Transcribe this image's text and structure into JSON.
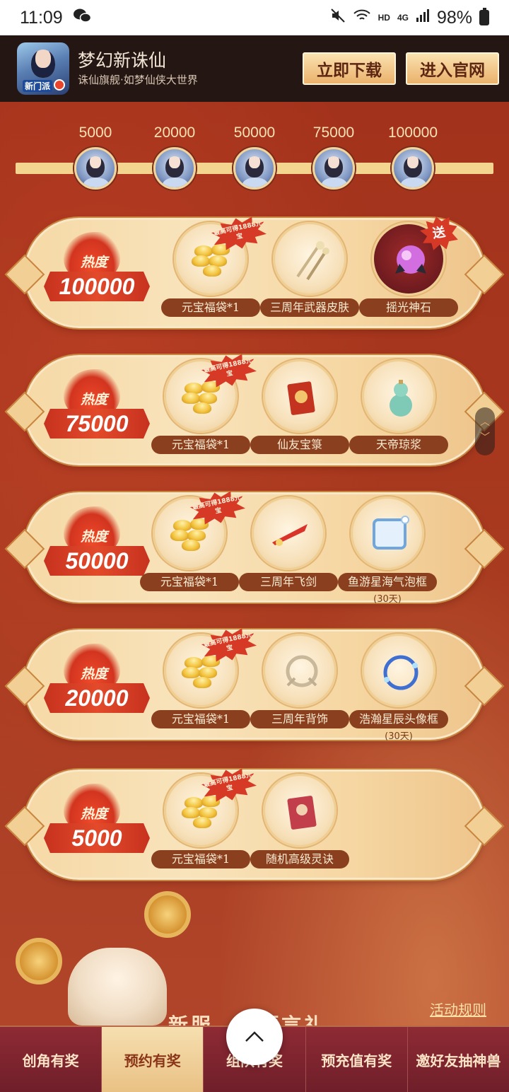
{
  "status_bar": {
    "time": "11:09",
    "network": "HD",
    "signal": "4G",
    "battery": "98%"
  },
  "header": {
    "app_name": "梦幻新诛仙",
    "subtitle": "诛仙旗舰·如梦仙侠大世界",
    "logo_text": "新门派",
    "download_label": "立即下载",
    "website_label": "进入官网"
  },
  "progress": {
    "milestones": [
      "5000",
      "20000",
      "50000",
      "75000",
      "100000"
    ]
  },
  "tiers": [
    {
      "heat_label": "热度",
      "heat_value": "100000",
      "items": [
        {
          "label": "元宝福袋*1",
          "badge": "最高可得1888元宝",
          "icon": "gold-ingot-icon"
        },
        {
          "label": "三周年武器皮肤",
          "icon": "weapon-skin-icon"
        },
        {
          "label": "摇光神石",
          "badge": "送",
          "icon": "stone-icon"
        }
      ]
    },
    {
      "heat_label": "热度",
      "heat_value": "75000",
      "items": [
        {
          "label": "元宝福袋*1",
          "badge": "最高可得1888元宝",
          "icon": "gold-ingot-icon"
        },
        {
          "label": "仙友宝箓",
          "icon": "book-icon"
        },
        {
          "label": "天帝琼浆",
          "icon": "gourd-icon"
        }
      ]
    },
    {
      "heat_label": "热度",
      "heat_value": "50000",
      "items": [
        {
          "label": "元宝福袋*1",
          "badge": "最高可得1888元宝",
          "icon": "gold-ingot-icon"
        },
        {
          "label": "三周年飞剑",
          "icon": "flying-sword-icon"
        },
        {
          "label": "鱼游星海气泡框",
          "sub": "(30天)",
          "icon": "bubble-frame-icon"
        }
      ]
    },
    {
      "heat_label": "热度",
      "heat_value": "20000",
      "items": [
        {
          "label": "元宝福袋*1",
          "badge": "最高可得1888元宝",
          "icon": "gold-ingot-icon"
        },
        {
          "label": "三周年背饰",
          "icon": "back-ornament-icon"
        },
        {
          "label": "浩瀚星辰头像框",
          "sub": "(30天)",
          "icon": "avatar-frame-icon"
        }
      ]
    },
    {
      "heat_label": "热度",
      "heat_value": "5000",
      "items": [
        {
          "label": "元宝福袋*1",
          "badge": "最高可得1888元宝",
          "icon": "gold-ingot-icon"
        },
        {
          "label": "随机高级灵诀",
          "icon": "spell-book-icon"
        }
      ]
    }
  ],
  "rules_link": "活动规则",
  "bottom_title": "新服",
  "bottom_title_tail": "预言礼",
  "nav": {
    "tabs": [
      "创角有奖",
      "预约有奖",
      "组队有奖",
      "预充值有奖",
      "邀好友抽神兽"
    ],
    "active_index": 1
  }
}
